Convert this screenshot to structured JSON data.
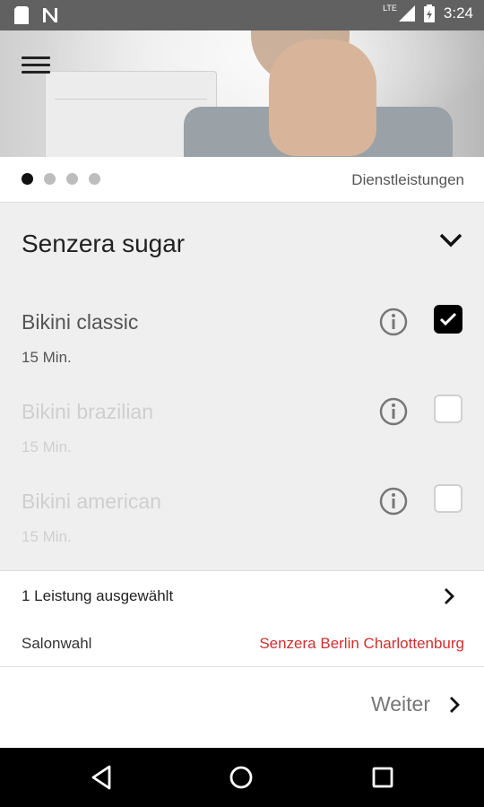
{
  "status_bar": {
    "time": "3:24",
    "network": "LTE",
    "icons": [
      "sd-card-icon",
      "n-notification-icon",
      "signal-icon",
      "battery-icon"
    ]
  },
  "header": {
    "menu_icon": "hamburger-menu-icon",
    "pager": {
      "total": 4,
      "active_index": 0
    },
    "step_label": "Dienstleistungen"
  },
  "section": {
    "title": "Senzera sugar",
    "toggle_icon": "chevron-down-icon"
  },
  "services": [
    {
      "name": "Bikini classic",
      "duration": "15 Min.",
      "checked": true,
      "enabled": true
    },
    {
      "name": "Bikini brazilian",
      "duration": "15 Min.",
      "checked": false,
      "enabled": false
    },
    {
      "name": "Bikini american",
      "duration": "15 Min.",
      "checked": false,
      "enabled": false
    }
  ],
  "summary": {
    "text": "1 Leistung ausgewählt"
  },
  "salon": {
    "label": "Salonwahl",
    "value": "Senzera Berlin Charlottenburg"
  },
  "footer": {
    "next_label": "Weiter"
  },
  "colors": {
    "accent": "#d32f2f",
    "status_bar": "#616161",
    "list_bg": "#efefef"
  },
  "nav": {
    "items": [
      "back-icon",
      "home-icon",
      "recents-icon"
    ]
  }
}
